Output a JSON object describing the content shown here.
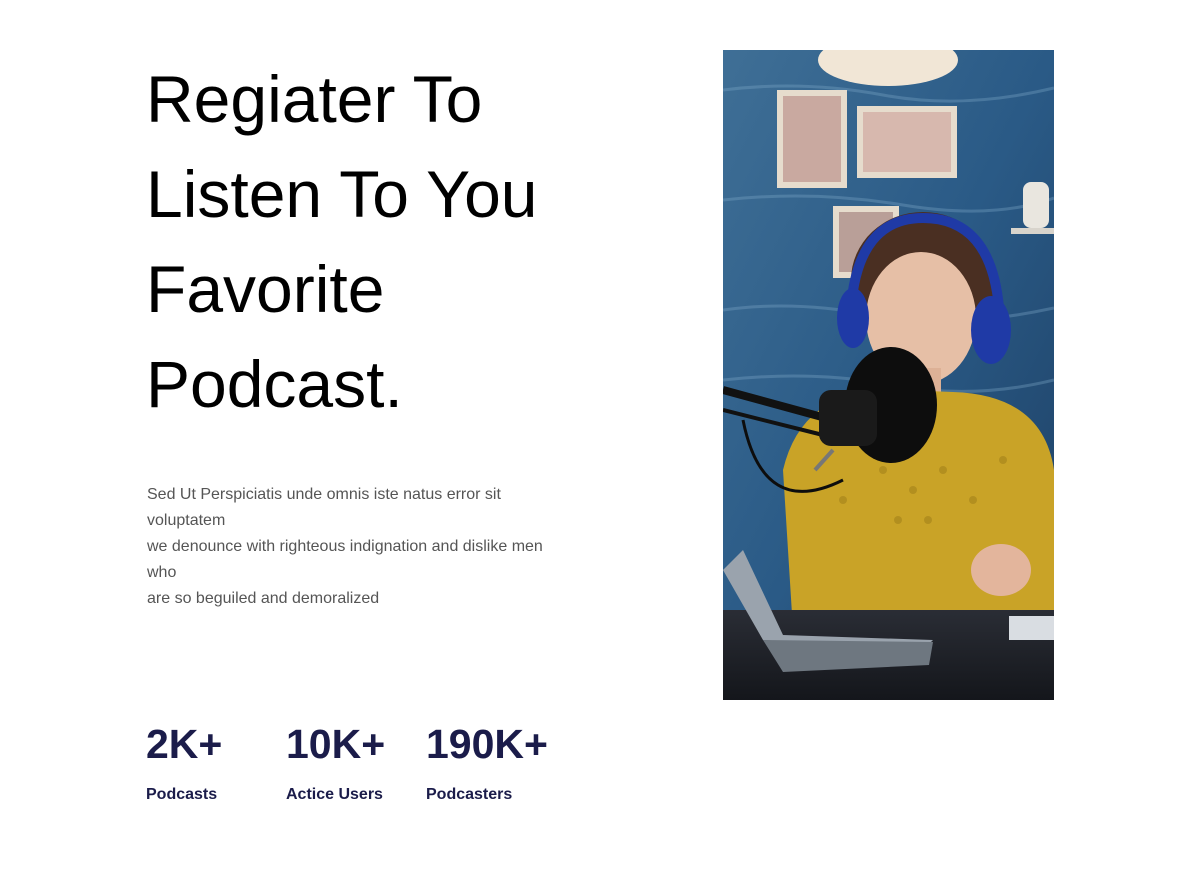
{
  "hero": {
    "title_lines": [
      "Regiater To",
      "Listen To You",
      "Favorite",
      "Podcast."
    ],
    "description_lines": [
      "Sed Ut Perspiciatis unde omnis iste natus error sit",
      "voluptatem",
      "we denounce with righteous indignation and dislike men",
      "who",
      "are so beguiled and demoralized"
    ],
    "photo": {
      "icon": "podcaster-photo",
      "subject": "woman with headphones speaking into a microphone"
    }
  },
  "stats": [
    {
      "value": "2K+",
      "label": "Podcasts"
    },
    {
      "value": "10K+",
      "label": "Actice Users"
    },
    {
      "value": "190K+",
      "label": "Podcasters"
    }
  ],
  "colors": {
    "heading": "#000000",
    "body_text": "#555555",
    "stat_accent": "#1b1c4a",
    "photo_wall": "#2d5d88",
    "sweater": "#c9a327",
    "headphones": "#1f3aa6"
  }
}
